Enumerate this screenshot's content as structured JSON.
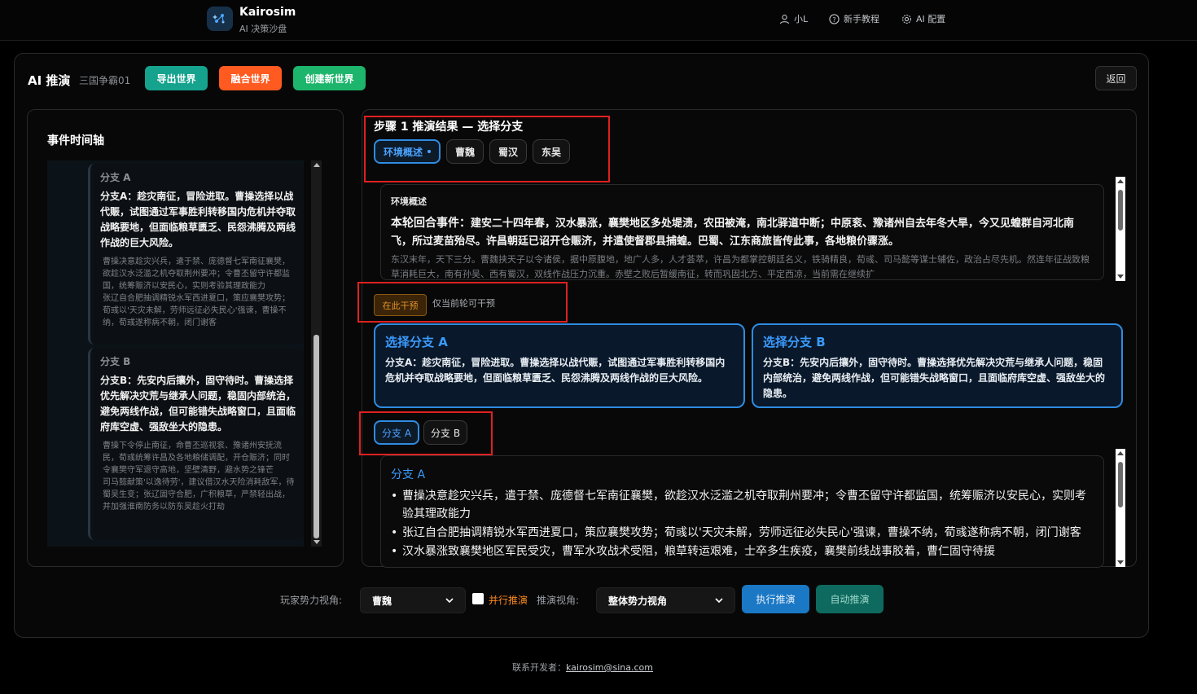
{
  "header": {
    "brand_name": "Kairosim",
    "brand_sub": "AI 决策沙盘",
    "nav": [
      {
        "label": "小L",
        "icon": "user-icon"
      },
      {
        "label": "新手教程",
        "icon": "help-icon"
      },
      {
        "label": "AI 配置",
        "icon": "gear-icon"
      }
    ]
  },
  "panel": {
    "title": "AI 推演",
    "world_name": "三国争霸01",
    "buttons": {
      "export": "导出世界",
      "merge": "融合世界",
      "create": "创建新世界",
      "back": "返回"
    }
  },
  "timeline": {
    "title": "事件时间轴",
    "items": [
      {
        "branch": "分支 A",
        "summary": "分支A：趁灾南征，冒险进取。曹操选择以战代赈，试图通过军事胜利转移国内危机并夺取战略要地，但面临粮草匮乏、民怨沸腾及两线作战的巨大风险。",
        "details": [
          "曹操决意趁灾兴兵，遣于禁、庞德督七军南征襄樊，欲趁汉水泛滥之机夺取荆州要冲；令曹丕留守许都监国，统筹赈济以安民心，实则考验其理政能力",
          "张辽自合肥抽调精锐水军西进夏口，策应襄樊攻势；荀彧以'天灾未解，劳师远征必失民心'强谏，曹操不纳，荀彧遂称病不朝，闭门谢客"
        ]
      },
      {
        "branch": "分支 B",
        "summary": "分支B：先安内后攘外，固守待时。曹操选择优先解决灾荒与继承人问题，稳固内部统治，避免两线作战，但可能错失战略窗口，且面临府库空虚、强敌坐大的隐患。",
        "details": [
          "曹操下令停止南征，命曹丕巡视衮、豫诸州安抚流民，荀彧统筹许昌及各地粮储调配，开仓赈济；同时令襄樊守军退守高地，坚壁清野，避水势之锋芒",
          "司马懿献策'以逸待劳'，建议借汉水天险消耗敌军，待蜀吴生变；张辽固守合肥，广积粮草，严禁轻出战，并加强淮南防务以防东吴趁火打劫"
        ]
      }
    ]
  },
  "main": {
    "step_title": "步骤 1 推演结果 — 选择分支",
    "tabs": [
      "环境概述",
      "曹魏",
      "蜀汉",
      "东吴"
    ],
    "env": {
      "label": "环境概述",
      "lead": "本轮回合事件：",
      "text": "建安二十四年春，汉水暴涨，襄樊地区多处堤溃，农田被淹，南北驿道中断；中原衮、豫诸州自去年冬大旱，今又见蝗群自河北南飞，所过麦苗殆尽。许昌朝廷已诏开仓赈济，并遣使督郡县捕蝗。巴蜀、江东商旅皆传此事，各地粮价骤涨。",
      "sub": "东汉末年，天下三分。曹魏挟天子以令诸侯，据中原腹地，地广人多，人才荟萃，许昌为都掌控朝廷名义，铁骑精良，荀彧、司马懿等谋士辅佐，政治占尽先机。然连年征战致粮草消耗巨大，南有孙吴、西有蜀汉，双线作战压力沉重。赤壁之败后暂缓南征，转而巩固北方、平定西凉，当前需在继续扩"
    },
    "intervene": {
      "button": "在此干预",
      "note": "仅当前轮可干预"
    },
    "choices": [
      {
        "title": "选择分支 A",
        "text": "分支A：趁灾南征，冒险进取。曹操选择以战代赈，试图通过军事胜利转移国内危机并夺取战略要地，但面临粮草匮乏、民怨沸腾及两线作战的巨大风险。"
      },
      {
        "title": "选择分支 B",
        "text": "分支B：先安内后攘外，固守待时。曹操选择优先解决灾荒与继承人问题，稳固内部统治，避免两线作战，但可能错失战略窗口，且面临府库空虚、强敌坐大的隐患。"
      }
    ],
    "branch_tabs": [
      "分支 A",
      "分支 B"
    ],
    "detail": {
      "title": "分支 A",
      "items": [
        "曹操决意趁灾兴兵，遣于禁、庞德督七军南征襄樊，欲趁汉水泛滥之机夺取荆州要冲；令曹丕留守许都监国，统筹赈济以安民心，实则考验其理政能力",
        "张辽自合肥抽调精锐水军西进夏口，策应襄樊攻势；荀彧以'天灾未解，劳师远征必失民心'强谏，曹操不纳，荀彧遂称病不朝，闭门谢客",
        "汉水暴涨致襄樊地区军民受灾，曹军水攻战术受阻，粮草转运艰难，士卒多生疾疫，襄樊前线战事胶着，曹仁固守待援"
      ]
    }
  },
  "controls": {
    "player_label": "玩家势力视角:",
    "player_value": "曹魏",
    "parallel_label": "并行推演",
    "view_label": "推演视角:",
    "view_value": "整体势力视角",
    "run_label": "执行推演",
    "auto_label": "自动推演"
  },
  "footer": {
    "label": "联系开发者：",
    "email": "kairosim@sina.com"
  },
  "colors": {
    "accent_blue": "#2f8ce0",
    "export_teal": "#15a38e",
    "merge_orange": "#ff5a1f",
    "create_green": "#1db56b",
    "highlight_red": "#e02020"
  }
}
